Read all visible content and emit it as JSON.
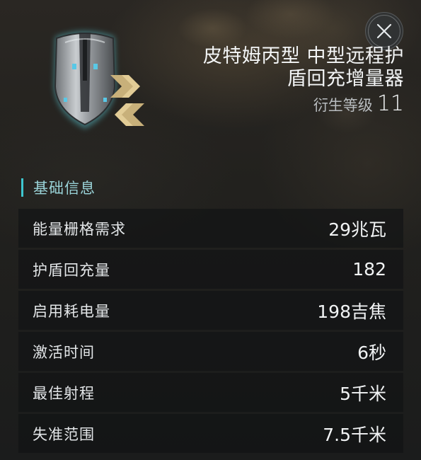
{
  "item": {
    "name_line1": "皮特姆丙型 中型远程护",
    "name_line2": "盾回充增量器",
    "meta_label": "衍生等级",
    "meta_value": "11",
    "icon": "shield-booster-icon",
    "rank_icon": "double-chevron-icon"
  },
  "close": {
    "icon": "close-icon"
  },
  "section": {
    "title": "基础信息",
    "accent": "#3ec6cf"
  },
  "stats": [
    {
      "label": "能量栅格需求",
      "value": "29兆瓦"
    },
    {
      "label": "护盾回充量",
      "value": "182"
    },
    {
      "label": "启用耗电量",
      "value": "198吉焦"
    },
    {
      "label": "激活时间",
      "value": "6秒"
    },
    {
      "label": "最佳射程",
      "value": "5千米"
    },
    {
      "label": "失准范围",
      "value": "7.5千米"
    }
  ]
}
